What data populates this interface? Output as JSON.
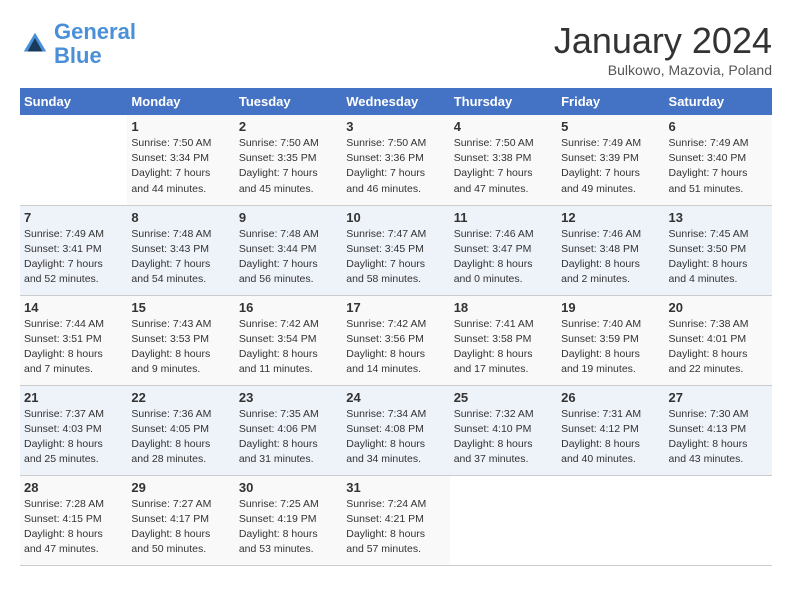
{
  "logo": {
    "line1": "General",
    "line2": "Blue"
  },
  "title": "January 2024",
  "subtitle": "Bulkowo, Mazovia, Poland",
  "days_of_week": [
    "Sunday",
    "Monday",
    "Tuesday",
    "Wednesday",
    "Thursday",
    "Friday",
    "Saturday"
  ],
  "weeks": [
    [
      {
        "day": "",
        "info": ""
      },
      {
        "day": "1",
        "info": "Sunrise: 7:50 AM\nSunset: 3:34 PM\nDaylight: 7 hours\nand 44 minutes."
      },
      {
        "day": "2",
        "info": "Sunrise: 7:50 AM\nSunset: 3:35 PM\nDaylight: 7 hours\nand 45 minutes."
      },
      {
        "day": "3",
        "info": "Sunrise: 7:50 AM\nSunset: 3:36 PM\nDaylight: 7 hours\nand 46 minutes."
      },
      {
        "day": "4",
        "info": "Sunrise: 7:50 AM\nSunset: 3:38 PM\nDaylight: 7 hours\nand 47 minutes."
      },
      {
        "day": "5",
        "info": "Sunrise: 7:49 AM\nSunset: 3:39 PM\nDaylight: 7 hours\nand 49 minutes."
      },
      {
        "day": "6",
        "info": "Sunrise: 7:49 AM\nSunset: 3:40 PM\nDaylight: 7 hours\nand 51 minutes."
      }
    ],
    [
      {
        "day": "7",
        "info": "Sunrise: 7:49 AM\nSunset: 3:41 PM\nDaylight: 7 hours\nand 52 minutes."
      },
      {
        "day": "8",
        "info": "Sunrise: 7:48 AM\nSunset: 3:43 PM\nDaylight: 7 hours\nand 54 minutes."
      },
      {
        "day": "9",
        "info": "Sunrise: 7:48 AM\nSunset: 3:44 PM\nDaylight: 7 hours\nand 56 minutes."
      },
      {
        "day": "10",
        "info": "Sunrise: 7:47 AM\nSunset: 3:45 PM\nDaylight: 7 hours\nand 58 minutes."
      },
      {
        "day": "11",
        "info": "Sunrise: 7:46 AM\nSunset: 3:47 PM\nDaylight: 8 hours\nand 0 minutes."
      },
      {
        "day": "12",
        "info": "Sunrise: 7:46 AM\nSunset: 3:48 PM\nDaylight: 8 hours\nand 2 minutes."
      },
      {
        "day": "13",
        "info": "Sunrise: 7:45 AM\nSunset: 3:50 PM\nDaylight: 8 hours\nand 4 minutes."
      }
    ],
    [
      {
        "day": "14",
        "info": "Sunrise: 7:44 AM\nSunset: 3:51 PM\nDaylight: 8 hours\nand 7 minutes."
      },
      {
        "day": "15",
        "info": "Sunrise: 7:43 AM\nSunset: 3:53 PM\nDaylight: 8 hours\nand 9 minutes."
      },
      {
        "day": "16",
        "info": "Sunrise: 7:42 AM\nSunset: 3:54 PM\nDaylight: 8 hours\nand 11 minutes."
      },
      {
        "day": "17",
        "info": "Sunrise: 7:42 AM\nSunset: 3:56 PM\nDaylight: 8 hours\nand 14 minutes."
      },
      {
        "day": "18",
        "info": "Sunrise: 7:41 AM\nSunset: 3:58 PM\nDaylight: 8 hours\nand 17 minutes."
      },
      {
        "day": "19",
        "info": "Sunrise: 7:40 AM\nSunset: 3:59 PM\nDaylight: 8 hours\nand 19 minutes."
      },
      {
        "day": "20",
        "info": "Sunrise: 7:38 AM\nSunset: 4:01 PM\nDaylight: 8 hours\nand 22 minutes."
      }
    ],
    [
      {
        "day": "21",
        "info": "Sunrise: 7:37 AM\nSunset: 4:03 PM\nDaylight: 8 hours\nand 25 minutes."
      },
      {
        "day": "22",
        "info": "Sunrise: 7:36 AM\nSunset: 4:05 PM\nDaylight: 8 hours\nand 28 minutes."
      },
      {
        "day": "23",
        "info": "Sunrise: 7:35 AM\nSunset: 4:06 PM\nDaylight: 8 hours\nand 31 minutes."
      },
      {
        "day": "24",
        "info": "Sunrise: 7:34 AM\nSunset: 4:08 PM\nDaylight: 8 hours\nand 34 minutes."
      },
      {
        "day": "25",
        "info": "Sunrise: 7:32 AM\nSunset: 4:10 PM\nDaylight: 8 hours\nand 37 minutes."
      },
      {
        "day": "26",
        "info": "Sunrise: 7:31 AM\nSunset: 4:12 PM\nDaylight: 8 hours\nand 40 minutes."
      },
      {
        "day": "27",
        "info": "Sunrise: 7:30 AM\nSunset: 4:13 PM\nDaylight: 8 hours\nand 43 minutes."
      }
    ],
    [
      {
        "day": "28",
        "info": "Sunrise: 7:28 AM\nSunset: 4:15 PM\nDaylight: 8 hours\nand 47 minutes."
      },
      {
        "day": "29",
        "info": "Sunrise: 7:27 AM\nSunset: 4:17 PM\nDaylight: 8 hours\nand 50 minutes."
      },
      {
        "day": "30",
        "info": "Sunrise: 7:25 AM\nSunset: 4:19 PM\nDaylight: 8 hours\nand 53 minutes."
      },
      {
        "day": "31",
        "info": "Sunrise: 7:24 AM\nSunset: 4:21 PM\nDaylight: 8 hours\nand 57 minutes."
      },
      {
        "day": "",
        "info": ""
      },
      {
        "day": "",
        "info": ""
      },
      {
        "day": "",
        "info": ""
      }
    ]
  ]
}
